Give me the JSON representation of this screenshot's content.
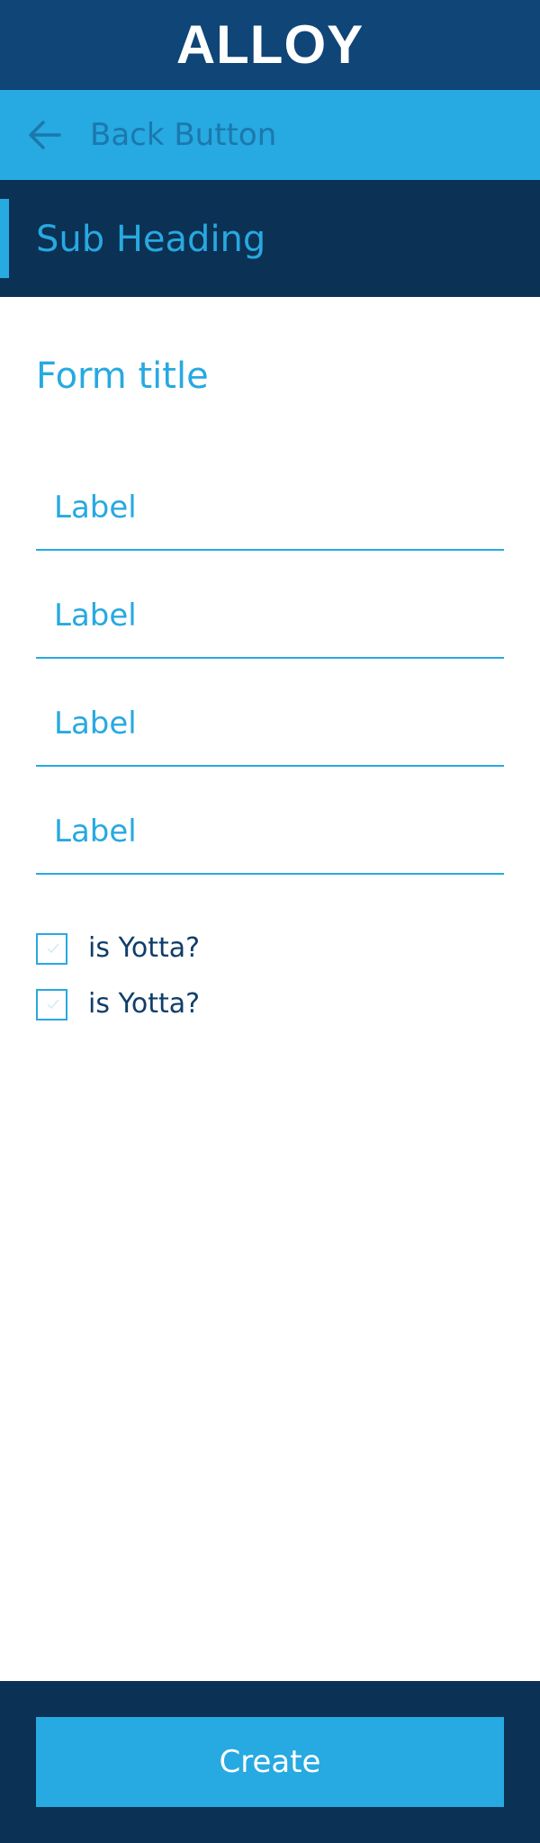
{
  "header": {
    "logo_text": "ALLOY"
  },
  "nav": {
    "back_icon": "arrow-left-icon",
    "back_label": "Back Button"
  },
  "subheading": {
    "text": "Sub Heading"
  },
  "form": {
    "title": "Form title",
    "fields": [
      {
        "label": "Label"
      },
      {
        "label": "Label"
      },
      {
        "label": "Label"
      },
      {
        "label": "Label"
      }
    ],
    "checkboxes": [
      {
        "label": "is Yotta?",
        "checked": false
      },
      {
        "label": "is Yotta?",
        "checked": false
      }
    ]
  },
  "footer": {
    "create_label": "Create"
  },
  "colors": {
    "primary_dark": "#0f4577",
    "navy": "#0b3154",
    "accent": "#27a9e1",
    "back_text": "#1b78ad",
    "checkbox_text": "#0f3e6b"
  }
}
